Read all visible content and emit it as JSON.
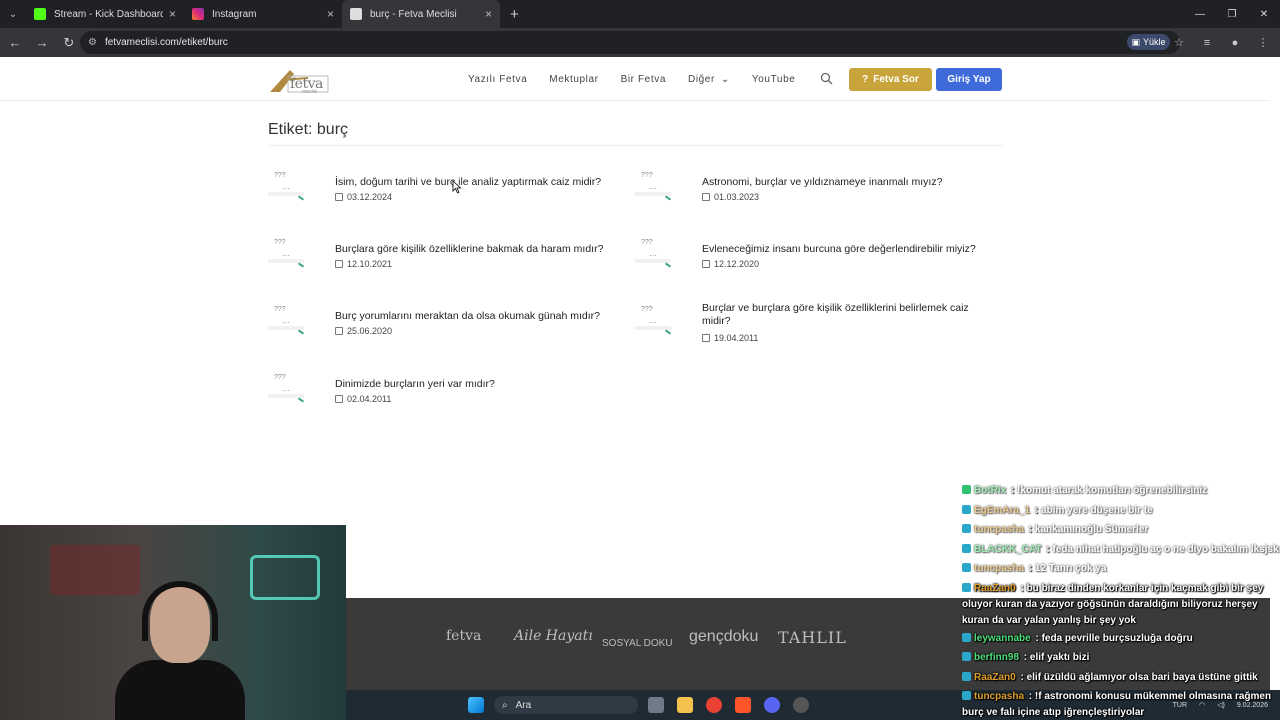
{
  "browser": {
    "tabs": [
      {
        "title": "Stream - Kick Dashboard",
        "favicon_color": "#53fc18",
        "active": false
      },
      {
        "title": "Instagram",
        "favicon_color": "#e1306c",
        "active": false
      },
      {
        "title": "burç - Fetva Meclisi",
        "favicon_color": "#cccccc",
        "active": true
      }
    ],
    "new_tab": "+",
    "url": "fetvameclisi.com/etiket/burc",
    "upload_label": "Yükle"
  },
  "site": {
    "logo_text": "fetva",
    "logo_sub": "meclisi",
    "nav": [
      "Yazılı Fetva",
      "Mektuplar",
      "Bir Fetva",
      "Diğer",
      "YouTube"
    ],
    "ask_button": "Fetva Sor",
    "login_button": "Giriş Yap",
    "page_title": "Etiket: burç",
    "thumb_text": "???",
    "posts": [
      {
        "title": "İsim, doğum tarihi ve burç ile analiz yaptırmak caiz midir?",
        "date": "03.12.2024"
      },
      {
        "title": "Astronomi, burçlar ve yıldıznameye inanmalı mıyız?",
        "date": "01.03.2023"
      },
      {
        "title": "Burçlara göre kişilik özelliklerine bakmak da haram mıdır?",
        "date": "12.10.2021"
      },
      {
        "title": "Evleneceğimiz insanı burcuna göre değerlendirebilir miyiz?",
        "date": "12.12.2020"
      },
      {
        "title": "Burç yorumlarını meraktan da olsa okumak günah mıdır?",
        "date": "25.06.2020"
      },
      {
        "title": "Burçlar ve burçlara göre kişilik özelliklerini belirlemek caiz midir?",
        "date": "19.04.2011"
      },
      {
        "title": "Dinimizde burçların yeri var mıdır?",
        "date": "02.04.2011"
      }
    ],
    "footer_logos": [
      "fetva",
      "Aile Hayatı",
      "SOSYAL DOKU",
      "gençdoku",
      "TAHLIL"
    ]
  },
  "taskbar": {
    "search_label": "Ara",
    "lang": "TUR",
    "date": "9.02.2026"
  },
  "chat": [
    {
      "user": "BotRix",
      "user_color": "#4fe07a",
      "msg": "!komut atarak komutları öğrenebilirsiniz",
      "dim": true
    },
    {
      "user": "EgEmAra_1",
      "user_color": "#e0a030",
      "msg": "abim yere düşene bir te",
      "dim": true
    },
    {
      "user": "tuncpasha",
      "user_color": "#e0a030",
      "msg": "kankamınoğlu Sümerler",
      "dim": true
    },
    {
      "user": "BLACKK_CAT",
      "user_color": "#4fe07a",
      "msg": "feda nihat hatipoğlu aç o ne diyo bakalım lksjsks",
      "dim": true
    },
    {
      "user": "tuncpasha",
      "user_color": "#e0a030",
      "msg": "12 Tanrı çok ya",
      "dim": true
    },
    {
      "user": "RaaZan0",
      "user_color": "#e0a030",
      "msg": "bu biraz dinden korkanlar için kaçmak gibi bir şey oluyor kuran da yazıyor göğsünün daraldığını biliyoruz herşey kuran da var yalan yanlış bir şey yok",
      "dim": false
    },
    {
      "user": "leywannabe",
      "user_color": "#4fe07a",
      "msg": "feda pevrille burçsuzluğa doğru",
      "dim": false
    },
    {
      "user": "berfinn98",
      "user_color": "#4fe07a",
      "msg": "elif yaktı bizi",
      "dim": false
    },
    {
      "user": "RaaZan0",
      "user_color": "#e0a030",
      "msg": "elif üzüldü ağlamıyor olsa bari baya üstüne gittik",
      "dim": false
    },
    {
      "user": "tuncpasha",
      "user_color": "#e0a030",
      "msg": "!f astronomi konusu mükemmel olmasına rağmen burç ve falı içine atıp iğrençleştiriyolar",
      "dim": false
    }
  ]
}
